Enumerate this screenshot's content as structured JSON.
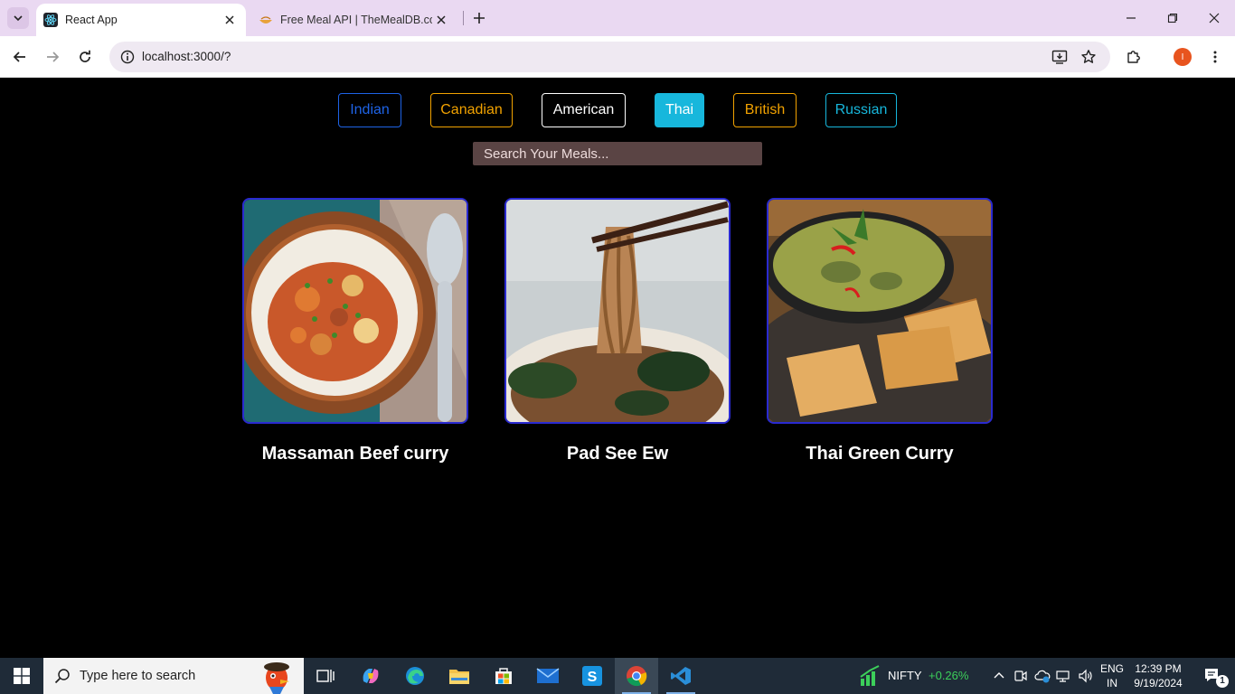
{
  "browser": {
    "tabs": [
      {
        "title": "React App",
        "active": true
      },
      {
        "title": "Free Meal API | TheMealDB.com",
        "active": false
      }
    ],
    "url": "localhost:3000/?"
  },
  "app": {
    "categories": [
      {
        "label": "Indian",
        "color": "#1e63e6",
        "selected": false
      },
      {
        "label": "Canadian",
        "color": "#f2a200",
        "selected": false
      },
      {
        "label": "American",
        "color": "#ffffff",
        "selected": false
      },
      {
        "label": "Thai",
        "color": "#17b7dc",
        "selected": true
      },
      {
        "label": "British",
        "color": "#f2a200",
        "selected": false
      },
      {
        "label": "Russian",
        "color": "#17b7dc",
        "selected": false
      }
    ],
    "search": {
      "placeholder": "Search Your Meals..."
    },
    "meals": [
      {
        "name": "Massaman Beef curry",
        "image": "massaman-beef-curry-photo"
      },
      {
        "name": "Pad See Ew",
        "image": "pad-see-ew-photo"
      },
      {
        "name": "Thai Green Curry",
        "image": "thai-green-curry-photo"
      }
    ]
  },
  "taskbar": {
    "search_placeholder": "Type here to search",
    "ticker": {
      "name": "NIFTY",
      "change": "+0.26%",
      "change_color": "#3ccf5a"
    },
    "language": {
      "line1": "ENG",
      "line2": "IN"
    },
    "clock": {
      "time": "12:39 PM",
      "date": "9/19/2024"
    },
    "notification_count": "1"
  }
}
